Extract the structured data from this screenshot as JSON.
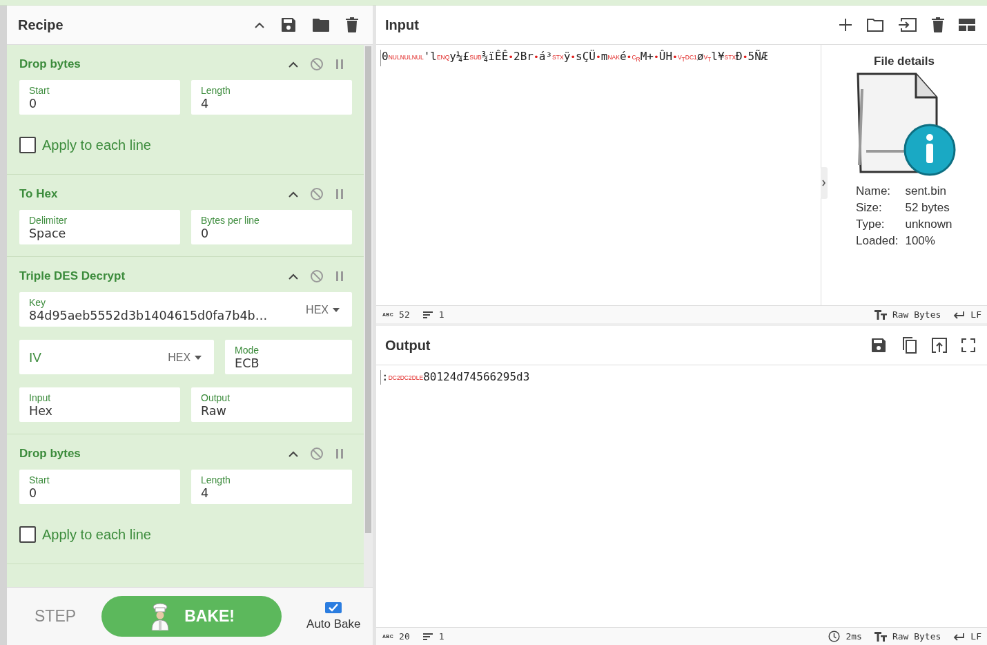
{
  "recipe": {
    "title": "Recipe",
    "operations": [
      {
        "name": "Drop bytes",
        "rows": [
          [
            {
              "kind": "field",
              "label": "Start",
              "value": "0"
            },
            {
              "kind": "field",
              "label": "Length",
              "value": "4"
            }
          ],
          [
            {
              "kind": "checkbox",
              "label": "Apply to each line",
              "checked": false
            }
          ]
        ]
      },
      {
        "name": "To Hex",
        "rows": [
          [
            {
              "kind": "field",
              "label": "Delimiter",
              "value": "Space"
            },
            {
              "kind": "field",
              "label": "Bytes per line",
              "value": "0"
            }
          ]
        ]
      },
      {
        "name": "Triple DES Decrypt",
        "rows": [
          [
            {
              "kind": "field-option",
              "label": "Key",
              "value": "84d95aeb5552d3b1404615d0fa7b4b…",
              "option": "HEX"
            }
          ],
          [
            {
              "kind": "option",
              "label": "IV",
              "option": "HEX"
            },
            {
              "kind": "field",
              "label": "Mode",
              "value": "ECB"
            }
          ],
          [
            {
              "kind": "field",
              "label": "Input",
              "value": "Hex"
            },
            {
              "kind": "field",
              "label": "Output",
              "value": "Raw"
            }
          ]
        ]
      },
      {
        "name": "Drop bytes",
        "rows": [
          [
            {
              "kind": "field",
              "label": "Start",
              "value": "0"
            },
            {
              "kind": "field",
              "label": "Length",
              "value": "4"
            }
          ],
          [
            {
              "kind": "checkbox",
              "label": "Apply to each line",
              "checked": false
            }
          ]
        ]
      }
    ]
  },
  "controls": {
    "step": "STEP",
    "bake": "BAKE!",
    "auto_bake": {
      "label": "Auto Bake",
      "checked": true
    }
  },
  "input": {
    "title": "Input",
    "segments": [
      {
        "kind": "text",
        "text": "0"
      },
      {
        "kind": "control",
        "text": "NULNULNUL"
      },
      {
        "kind": "text",
        "text": "'l"
      },
      {
        "kind": "control",
        "text": "ENQ"
      },
      {
        "kind": "text",
        "text": "y¼£"
      },
      {
        "kind": "control",
        "text": "SUB"
      },
      {
        "kind": "text",
        "text": "¾ïÊÊ"
      },
      {
        "kind": "dot",
        "text": "•"
      },
      {
        "kind": "text",
        "text": "2Br"
      },
      {
        "kind": "dot",
        "text": "•"
      },
      {
        "kind": "text",
        "text": "á³"
      },
      {
        "kind": "control",
        "text": "STX"
      },
      {
        "kind": "text",
        "text": "ÿ"
      },
      {
        "kind": "dot",
        "text": "•"
      },
      {
        "kind": "text",
        "text": "sÇÜ"
      },
      {
        "kind": "dot",
        "text": "•"
      },
      {
        "kind": "text",
        "text": "m"
      },
      {
        "kind": "control",
        "text": "NAK"
      },
      {
        "kind": "text",
        "text": "é"
      },
      {
        "kind": "dot",
        "text": "•"
      },
      {
        "kind": "control",
        "text": "C$_{R}$"
      },
      {
        "kind": "text",
        "text": "M+"
      },
      {
        "kind": "dot",
        "text": "•"
      },
      {
        "kind": "text",
        "text": "ÛH"
      },
      {
        "kind": "dot",
        "text": "•"
      },
      {
        "kind": "control",
        "text": "V$_{T}$"
      },
      {
        "kind": "control",
        "text": "DC1"
      },
      {
        "kind": "text",
        "text": "ø"
      },
      {
        "kind": "control",
        "text": "V$_{T}$"
      },
      {
        "kind": "text",
        "text": "l¥"
      },
      {
        "kind": "control",
        "text": "STX"
      },
      {
        "kind": "text",
        "text": "Ð"
      },
      {
        "kind": "dot",
        "text": "•"
      },
      {
        "kind": "text",
        "text": "5ÑÆ"
      }
    ],
    "status": {
      "abc": "ABC",
      "length": "52",
      "lines": "1",
      "encoding": "Raw Bytes",
      "eol": "LF"
    }
  },
  "file_details": {
    "title": "File details",
    "properties": [
      {
        "label": "Name:",
        "value": "sent.bin"
      },
      {
        "label": "Size:",
        "value": "52 bytes"
      },
      {
        "label": "Type:",
        "value": "unknown"
      },
      {
        "label": "Loaded:",
        "value": "100%"
      }
    ]
  },
  "output": {
    "title": "Output",
    "segments": [
      {
        "kind": "text",
        "text": ":"
      },
      {
        "kind": "control",
        "text": "DC2DC2DLE"
      },
      {
        "kind": "text",
        "text": "80124d74566295d3"
      }
    ],
    "status": {
      "abc": "ABC",
      "length": "20",
      "lines": "1",
      "time": "2ms",
      "encoding": "Raw Bytes",
      "eol": "LF"
    }
  }
}
